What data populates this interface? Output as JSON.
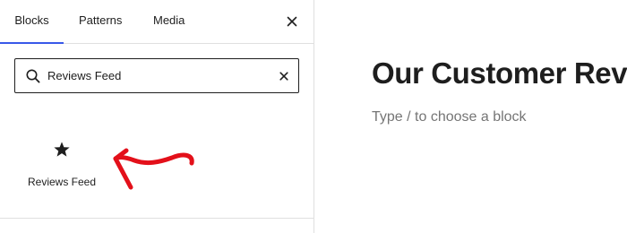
{
  "inserter": {
    "tabs": [
      {
        "label": "Blocks",
        "active": true
      },
      {
        "label": "Patterns",
        "active": false
      },
      {
        "label": "Media",
        "active": false
      }
    ],
    "close_icon": "close-icon",
    "search": {
      "icon": "search-icon",
      "value": "Reviews Feed",
      "clear_icon": "clear-icon"
    },
    "results": [
      {
        "label": "Reviews Feed",
        "icon": "star-icon"
      }
    ]
  },
  "annotation": {
    "icon": "curved-arrow-icon",
    "color": "#e3101a"
  },
  "editor": {
    "title": "Our Customer Reviews",
    "block_placeholder": "Type / to choose a block"
  },
  "colors": {
    "accent": "#3858e9",
    "text": "#1e1e1e",
    "muted": "#757575",
    "border": "#e0e0e0"
  }
}
